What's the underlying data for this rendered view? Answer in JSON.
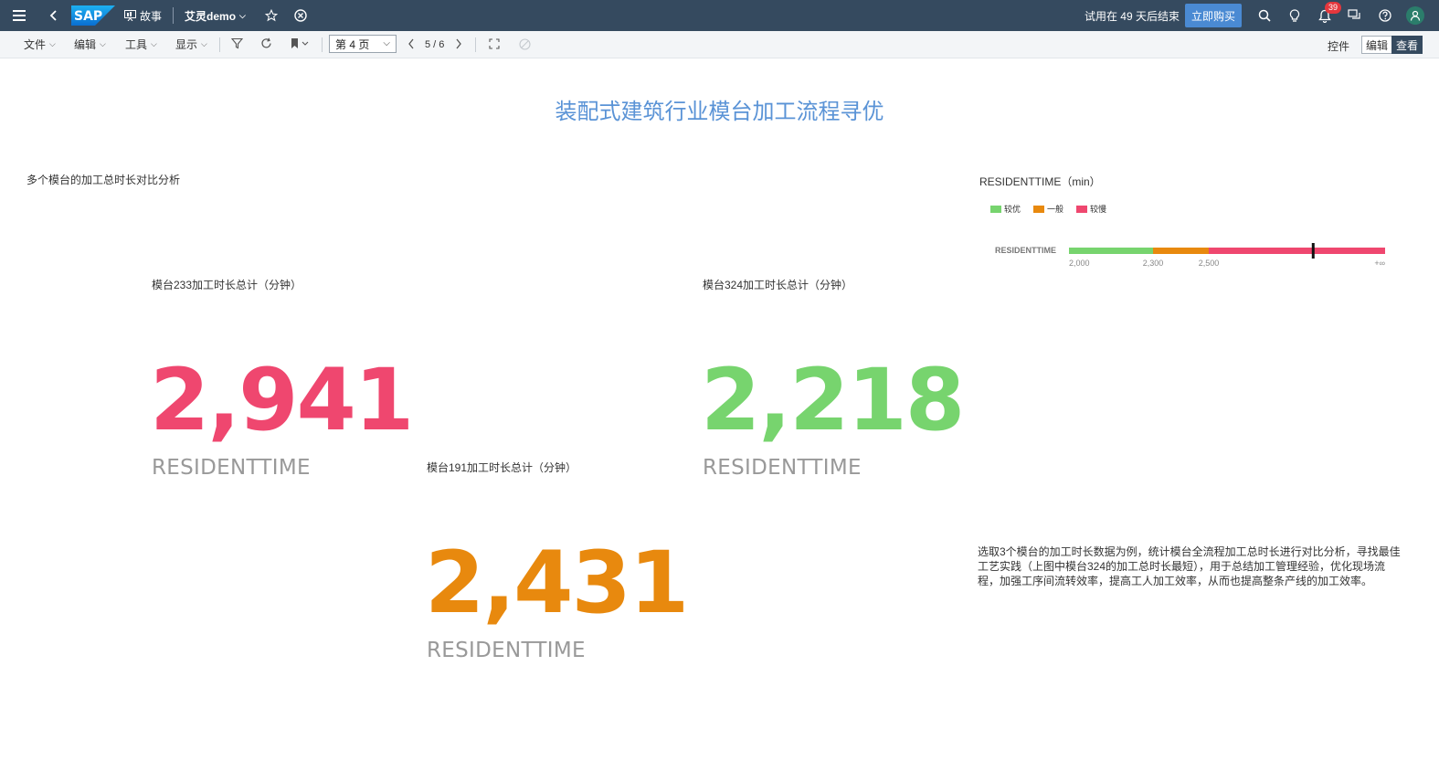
{
  "shell": {
    "story_label": "故事",
    "file_name": "艾灵demo",
    "trial_text": "试用在 49 天后结束",
    "buy_label": "立即购买",
    "notifications_count": "39",
    "brand_color": "#354a5f"
  },
  "toolbar": {
    "file": "文件",
    "edit": "编辑",
    "tools": "工具",
    "display": "显示",
    "page_select": "第 4 页",
    "page_counter": "5 / 6",
    "controls": "控件",
    "mode_edit": "编辑",
    "mode_view": "查看"
  },
  "page": {
    "title": "装配式建筑行业模台加工流程寻优",
    "section_label": "多个模台的加工总时长对比分析",
    "description": "选取3个模台的加工时长数据为例，统计模台全流程加工总时长进行对比分析，寻找最佳工艺实践（上图中模台324的加工总时长最短），用于总结加工管理经验，优化现场流程，加强工序间流转效率，提高工人加工效率，从而也提高整条产线的加工效率。"
  },
  "kpis": [
    {
      "label": "模台233加工时长总计（分钟）",
      "value": "2,941",
      "unit": "RESIDENTTIME",
      "color": "#ef476f"
    },
    {
      "label": "模台324加工时长总计（分钟）",
      "value": "2,218",
      "unit": "RESIDENTTIME",
      "color": "#77d46e"
    },
    {
      "label": "模台191加工时长总计（分钟）",
      "value": "2,431",
      "unit": "RESIDENTTIME",
      "color": "#e8890e"
    }
  ],
  "chart_data": {
    "type": "bullet",
    "title": "RESIDENTTIME（min）",
    "measure_label": "RESIDENTTIME",
    "legend": [
      {
        "name": "较优",
        "color": "#77d46e"
      },
      {
        "name": "一般",
        "color": "#e8890e"
      },
      {
        "name": "较慢",
        "color": "#ef476f"
      }
    ],
    "ranges": [
      {
        "name": "较优",
        "from": 2000,
        "to": 2300
      },
      {
        "name": "一般",
        "from": 2300,
        "to": 2500
      },
      {
        "name": "较慢",
        "from": 2500,
        "to": "+∞"
      }
    ],
    "tick_labels": [
      "2,000",
      "2,300",
      "2,500",
      "+∞"
    ],
    "marker_value": 2941
  }
}
